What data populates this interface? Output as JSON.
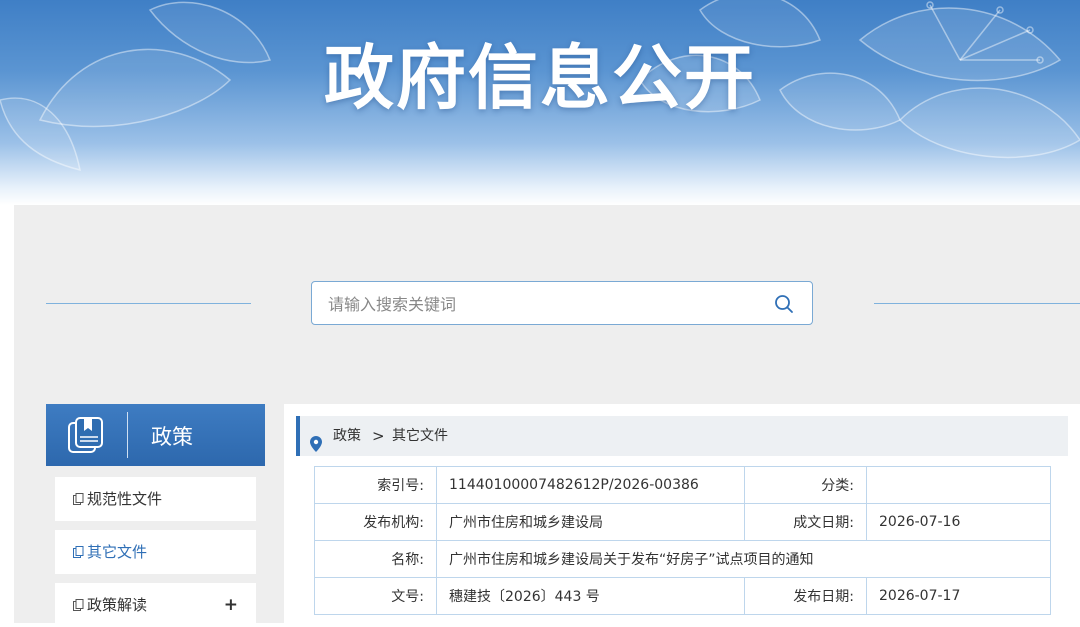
{
  "banner": {
    "title": "政府信息公开"
  },
  "search": {
    "placeholder": "请输入搜索关键词"
  },
  "sidebar": {
    "title": "政策",
    "items": [
      {
        "label": "规范性文件",
        "active": false
      },
      {
        "label": "其它文件",
        "active": true
      },
      {
        "label": "政策解读",
        "expand_symbol": "+"
      }
    ]
  },
  "breadcrumb": {
    "level1": "政策",
    "separator": ">",
    "level2": "其它文件"
  },
  "info": {
    "index_label": "索引号:",
    "index_value": "11440100007482612P/2026-00386",
    "category_label": "分类:",
    "category_value": "",
    "publisher_label": "发布机构:",
    "publisher_value": "广州市住房和城乡建设局",
    "created_label": "成文日期:",
    "created_value": "2026-07-16",
    "name_label": "名称:",
    "name_value": "广州市住房和城乡建设局关于发布“好房子”试点项目的通知",
    "docno_label": "文号:",
    "docno_value": "穗建技〔2026〕443 号",
    "published_label": "发布日期:",
    "published_value": "2026-07-17"
  },
  "colors": {
    "accent": "#2f6fb6",
    "banner_top": "#3f7fc6",
    "panel_bg": "#eeeeee",
    "table_border": "#bed6ec"
  }
}
